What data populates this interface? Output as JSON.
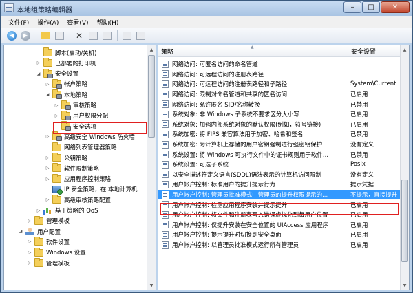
{
  "window": {
    "title": "本地组策略编辑器",
    "controls": {
      "minimize": "–",
      "maximize": "□",
      "close": "✕"
    }
  },
  "menu": [
    "文件(F)",
    "操作(A)",
    "查看(V)",
    "帮助(H)"
  ],
  "toolbar_icons": [
    "back-arrow-icon",
    "forward-arrow-icon",
    "up-folder-icon",
    "show-tree-icon",
    "delete-icon",
    "properties-icon",
    "export-list-icon",
    "help-icon",
    "show-hide-icon"
  ],
  "tree": [
    {
      "label": "脚本(启动/关机)",
      "indent": 2,
      "icon": "folder",
      "expander": ""
    },
    {
      "label": "已部署的打印机",
      "indent": 2,
      "icon": "folder",
      "expander": "▷"
    },
    {
      "label": "安全设置",
      "indent": 2,
      "icon": "lockfolder",
      "expander": "◢"
    },
    {
      "label": "帐户策略",
      "indent": 3,
      "icon": "lockfolder",
      "expander": "▷"
    },
    {
      "label": "本地策略",
      "indent": 3,
      "icon": "lockfolder",
      "expander": "◢"
    },
    {
      "label": "审核策略",
      "indent": 4,
      "icon": "lockfolder",
      "expander": "▷"
    },
    {
      "label": "用户权限分配",
      "indent": 4,
      "icon": "lockfolder",
      "expander": "▷"
    },
    {
      "label": "安全选项",
      "indent": 4,
      "icon": "lockfolder",
      "expander": ""
    },
    {
      "label": "高级安全 Windows 防火墙",
      "indent": 3,
      "icon": "lockfolder",
      "expander": "▷"
    },
    {
      "label": "网络列表管理器策略",
      "indent": 3,
      "icon": "folder",
      "expander": ""
    },
    {
      "label": "公钥策略",
      "indent": 3,
      "icon": "folder",
      "expander": "▷"
    },
    {
      "label": "软件限制策略",
      "indent": 3,
      "icon": "folder",
      "expander": "▷"
    },
    {
      "label": "应用程序控制策略",
      "indent": 3,
      "icon": "folder",
      "expander": "▷"
    },
    {
      "label": "IP 安全策略，在 本地计算机",
      "indent": 3,
      "icon": "net",
      "expander": ""
    },
    {
      "label": "高级审核策略配置",
      "indent": 3,
      "icon": "folder",
      "expander": "▷"
    },
    {
      "label": "基于策略的 QoS",
      "indent": 2,
      "icon": "bars",
      "expander": "▷"
    },
    {
      "label": "管理模板",
      "indent": 1,
      "icon": "folder",
      "expander": "▷"
    },
    {
      "label": "用户配置",
      "indent": 0,
      "icon": "user",
      "expander": "◢"
    },
    {
      "label": "软件设置",
      "indent": 1,
      "icon": "folder",
      "expander": "▷"
    },
    {
      "label": "Windows 设置",
      "indent": 1,
      "icon": "folder",
      "expander": "▷"
    },
    {
      "label": "管理模板",
      "indent": 1,
      "icon": "folder",
      "expander": "▷"
    }
  ],
  "selected_tree_item": "安全选项",
  "list": {
    "columns": [
      "策略",
      "安全设置"
    ],
    "rows": [
      {
        "policy": "网络访问: 可匿名访问的命名管道",
        "setting": ""
      },
      {
        "policy": "网络访问: 可远程访问的注册表路径",
        "setting": ""
      },
      {
        "policy": "网络访问: 可远程访问的注册表路径和子路径",
        "setting": "System\\Current"
      },
      {
        "policy": "网络访问: 限制对命名管道和共享的匿名访问",
        "setting": "已启用"
      },
      {
        "policy": "网络访问: 允许匿名 SID/名称转换",
        "setting": "已禁用"
      },
      {
        "policy": "系统对象: 非 Windows 子系统不要求区分大小写",
        "setting": "已启用"
      },
      {
        "policy": "系统对象: 加强内部系统对象的默认权限(例如，符号链接)",
        "setting": "已启用"
      },
      {
        "policy": "系统加密: 将 FIPS 兼容算法用于加密、哈希和签名",
        "setting": "已禁用"
      },
      {
        "policy": "系统加密: 为计算机上存储的用户密钥强制进行强密钥保护",
        "setting": "没有定义"
      },
      {
        "policy": "系统设置: 将 Windows 可执行文件中的证书规则用于软件...",
        "setting": "已禁用"
      },
      {
        "policy": "系统设置: 可选子系统",
        "setting": "Posix"
      },
      {
        "policy": "以安全描述符定义语言(SDDL)语法表示的计算机访问限制",
        "setting": "没有定义"
      },
      {
        "policy": "用户帐户控制: 标准用户的提升提示行为",
        "setting": "提示凭据"
      },
      {
        "policy": "用户帐户控制: 管理员批准模式中管理员的提升权限提示的...",
        "setting": "不提示，直接提升"
      },
      {
        "policy": "用户帐户控制: 检测应用程序安装并提示提升",
        "setting": "已启用"
      },
      {
        "policy": "用户帐户控制: 将文件和注册表写入错误虚拟化到每用户位置",
        "setting": "已启用"
      },
      {
        "policy": "用户帐户控制: 仅提升安装在安全位置的 UIAccess 应用程序",
        "setting": "已启用"
      },
      {
        "policy": "用户帐户控制: 提示提升时切换到安全桌面",
        "setting": "已启用"
      },
      {
        "policy": "用户帐户控制: 以管理员批准模式运行所有管理员",
        "setting": "已启用"
      }
    ],
    "selected_row": 13
  },
  "colors": {
    "selection": "#3399ff",
    "annotation_box": "#e02020",
    "window_frame": "#bcd3ec"
  }
}
